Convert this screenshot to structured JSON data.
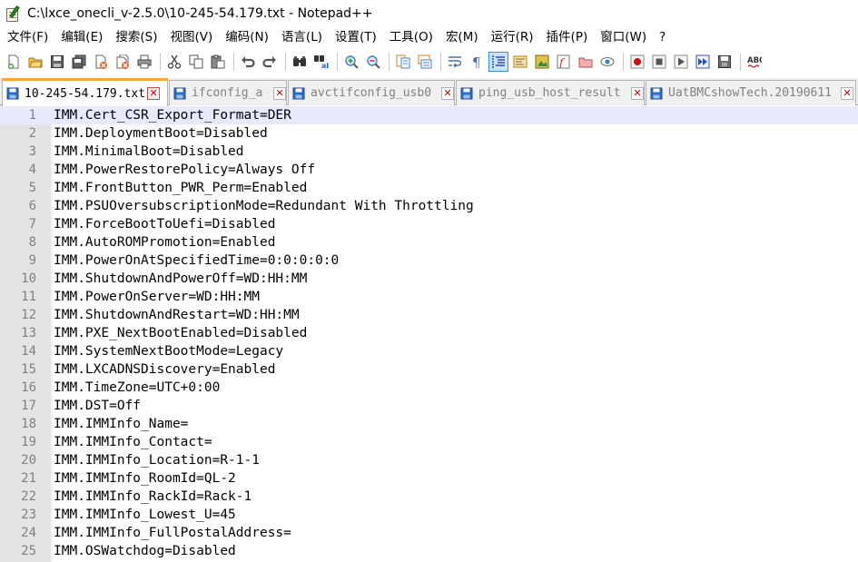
{
  "window": {
    "title": "C:\\lxce_onecli_v-2.5.0\\10-245-54.179.txt - Notepad++"
  },
  "menu": [
    {
      "label": "文件(F)"
    },
    {
      "label": "编辑(E)"
    },
    {
      "label": "搜索(S)"
    },
    {
      "label": "视图(V)"
    },
    {
      "label": "编码(N)"
    },
    {
      "label": "语言(L)"
    },
    {
      "label": "设置(T)"
    },
    {
      "label": "工具(O)"
    },
    {
      "label": "宏(M)"
    },
    {
      "label": "运行(R)"
    },
    {
      "label": "插件(P)"
    },
    {
      "label": "窗口(W)"
    },
    {
      "label": "?"
    }
  ],
  "toolbar": {
    "buttons": [
      "new-file-icon",
      "open-file-icon",
      "save-icon",
      "save-all-icon",
      "close-icon",
      "close-all-icon",
      "print-icon",
      "cut-icon",
      "copy-icon",
      "paste-icon",
      "undo-icon",
      "redo-icon",
      "find-icon",
      "replace-icon",
      "zoom-in-icon",
      "zoom-out-icon",
      "sync-vertical-icon",
      "sync-horizontal-icon",
      "word-wrap-icon",
      "show-all-characters-icon",
      "indent-guide-icon",
      "user-defined-language-icon",
      "document-map-icon",
      "function-list-icon",
      "folder-as-workspace-icon",
      "monitoring-icon",
      "record-macro-icon",
      "stop-recording-icon",
      "play-macro-icon",
      "run-macro-multiple-icon",
      "save-macro-icon",
      "spell-check-icon"
    ],
    "spell_check_text": "ABC"
  },
  "tabs": [
    {
      "label": "10-245-54.179.txt",
      "active": true
    },
    {
      "label": "ifconfig_a",
      "active": false
    },
    {
      "label": "avctifconfig_usb0",
      "active": false
    },
    {
      "label": "ping_usb_host_result",
      "active": false
    },
    {
      "label": "UatBMCshowTech.20190611",
      "active": false
    }
  ],
  "editor": {
    "current_line": 1,
    "lines": [
      {
        "n": "1",
        "text": "IMM.Cert_CSR_Export_Format=DER"
      },
      {
        "n": "2",
        "text": "IMM.DeploymentBoot=Disabled"
      },
      {
        "n": "3",
        "text": "IMM.MinimalBoot=Disabled"
      },
      {
        "n": "4",
        "text": "IMM.PowerRestorePolicy=Always Off"
      },
      {
        "n": "5",
        "text": "IMM.FrontButton_PWR_Perm=Enabled"
      },
      {
        "n": "6",
        "text": "IMM.PSUOversubscriptionMode=Redundant With Throttling"
      },
      {
        "n": "7",
        "text": "IMM.ForceBootToUefi=Disabled"
      },
      {
        "n": "8",
        "text": "IMM.AutoROMPromotion=Enabled"
      },
      {
        "n": "9",
        "text": "IMM.PowerOnAtSpecifiedTime=0:0:0:0:0"
      },
      {
        "n": "10",
        "text": "IMM.ShutdownAndPowerOff=WD:HH:MM"
      },
      {
        "n": "11",
        "text": "IMM.PowerOnServer=WD:HH:MM"
      },
      {
        "n": "12",
        "text": "IMM.ShutdownAndRestart=WD:HH:MM"
      },
      {
        "n": "13",
        "text": "IMM.PXE_NextBootEnabled=Disabled"
      },
      {
        "n": "14",
        "text": "IMM.SystemNextBootMode=Legacy"
      },
      {
        "n": "15",
        "text": "IMM.LXCADNSDiscovery=Enabled"
      },
      {
        "n": "16",
        "text": "IMM.TimeZone=UTC+0:00"
      },
      {
        "n": "17",
        "text": "IMM.DST=Off"
      },
      {
        "n": "18",
        "text": "IMM.IMMInfo_Name="
      },
      {
        "n": "19",
        "text": "IMM.IMMInfo_Contact="
      },
      {
        "n": "20",
        "text": "IMM.IMMInfo_Location=R-1-1"
      },
      {
        "n": "21",
        "text": "IMM.IMMInfo_RoomId=QL-2"
      },
      {
        "n": "22",
        "text": "IMM.IMMInfo_RackId=Rack-1"
      },
      {
        "n": "23",
        "text": "IMM.IMMInfo_Lowest_U=45"
      },
      {
        "n": "24",
        "text": "IMM.IMMInfo_FullPostalAddress="
      },
      {
        "n": "25",
        "text": "IMM.OSWatchdog=Disabled"
      }
    ]
  }
}
